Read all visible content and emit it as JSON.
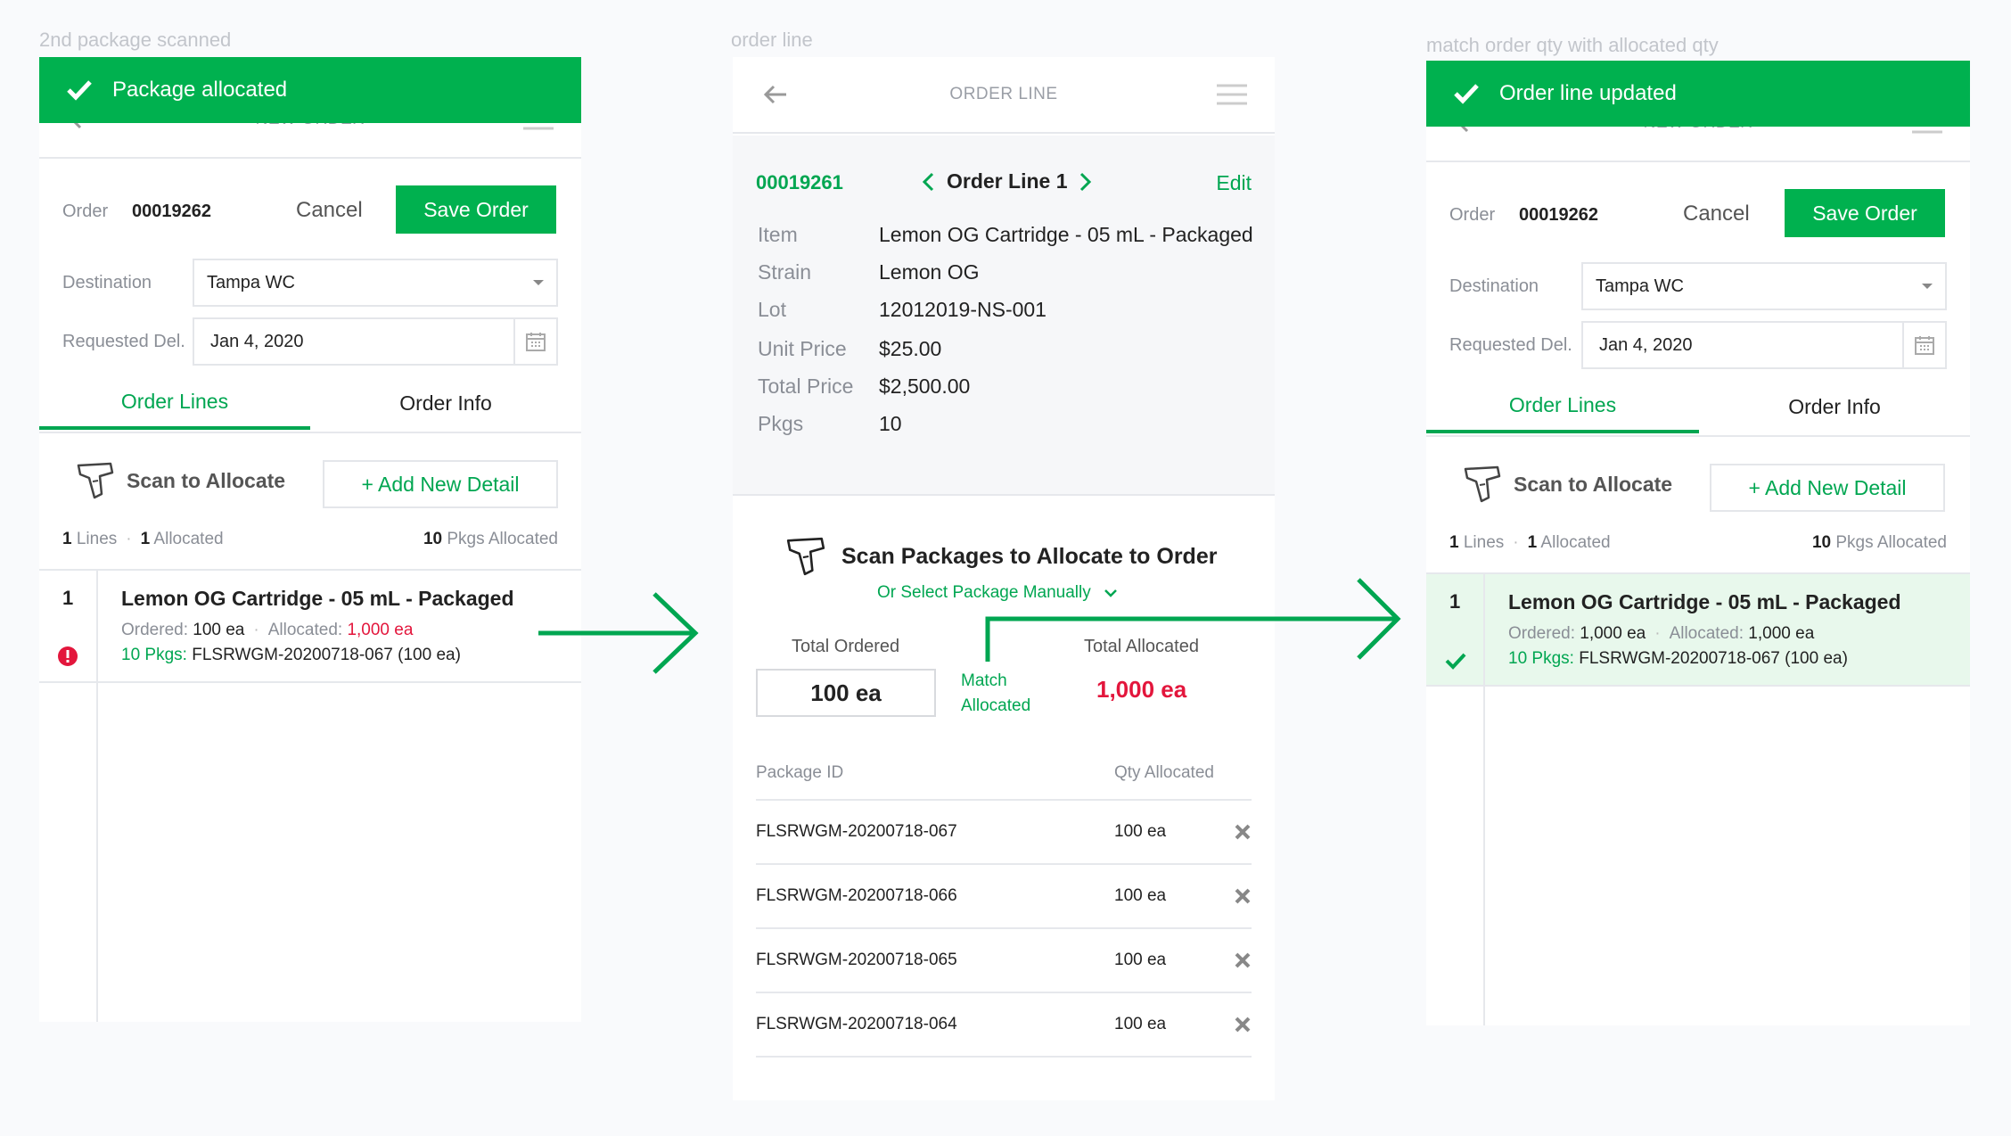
{
  "captions": {
    "left": "2nd package scanned",
    "middle": "order line",
    "right": "match order qty with allocated qty"
  },
  "left_panel": {
    "toast": "Package allocated",
    "header_title": "NEW ORDER",
    "order_label": "Order",
    "order_number": "00019262",
    "cancel_label": "Cancel",
    "save_label": "Save Order",
    "destination_label": "Destination",
    "destination_value": "Tampa WC",
    "requested_label": "Requested Del.",
    "requested_value": "Jan 4, 2020",
    "tabs": [
      "Order Lines",
      "Order Info"
    ],
    "scan_label": "Scan to Allocate",
    "add_label": "+ Add New Detail",
    "stats": {
      "lines_num": "1",
      "lines_label": "Lines",
      "alloc_num": "1",
      "alloc_label": "Allocated",
      "pkgs_num": "10",
      "pkgs_label": "Pkgs Allocated"
    },
    "line": {
      "num": "1",
      "name": "Lemon OG Cartridge - 05 mL - Packaged",
      "ordered_label": "Ordered:",
      "ordered_value": "100 ea",
      "allocated_label": "Allocated:",
      "allocated_value": "1,000 ea",
      "pkgs_label": "10 Pkgs:",
      "pkgs_value": "FLSRWGM-20200718-067 (100 ea)"
    }
  },
  "middle_panel": {
    "header_title": "ORDER LINE",
    "order_number": "00019261",
    "line_nav_label": "Order Line 1",
    "edit_label": "Edit",
    "details": [
      {
        "label": "Item",
        "value": "Lemon OG Cartridge - 05 mL - Packaged"
      },
      {
        "label": "Strain",
        "value": "Lemon OG"
      },
      {
        "label": "Lot",
        "value": "12012019-NS-001"
      },
      {
        "label": "Unit Price",
        "value": "$25.00"
      },
      {
        "label": "Total Price",
        "value": "$2,500.00"
      },
      {
        "label": "Pkgs",
        "value": "10"
      }
    ],
    "scan_title": "Scan Packages to Allocate to Order",
    "select_manually": "Or Select Package Manually",
    "total_ordered_label": "Total Ordered",
    "total_ordered_value": "100 ea",
    "match_label_1": "Match",
    "match_label_2": "Allocated",
    "total_allocated_label": "Total Allocated",
    "total_allocated_value": "1,000 ea",
    "col_package": "Package ID",
    "col_qty": "Qty Allocated",
    "packages": [
      {
        "id": "FLSRWGM-20200718-067",
        "qty": "100 ea"
      },
      {
        "id": "FLSRWGM-20200718-066",
        "qty": "100 ea"
      },
      {
        "id": "FLSRWGM-20200718-065",
        "qty": "100 ea"
      },
      {
        "id": "FLSRWGM-20200718-064",
        "qty": "100 ea"
      }
    ]
  },
  "right_panel": {
    "toast": "Order line updated",
    "header_title": "NEW ORDER",
    "order_label": "Order",
    "order_number": "00019262",
    "cancel_label": "Cancel",
    "save_label": "Save Order",
    "destination_label": "Destination",
    "destination_value": "Tampa WC",
    "requested_label": "Requested Del.",
    "requested_value": "Jan 4, 2020",
    "tabs": [
      "Order Lines",
      "Order Info"
    ],
    "scan_label": "Scan to Allocate",
    "add_label": "+ Add New Detail",
    "stats": {
      "lines_num": "1",
      "lines_label": "Lines",
      "alloc_num": "1",
      "alloc_label": "Allocated",
      "pkgs_num": "10",
      "pkgs_label": "Pkgs Allocated"
    },
    "line": {
      "num": "1",
      "name": "Lemon OG Cartridge - 05 mL - Packaged",
      "ordered_label": "Ordered:",
      "ordered_value": "1,000 ea",
      "allocated_label": "Allocated:",
      "allocated_value": "1,000 ea",
      "pkgs_label": "10 Pkgs:",
      "pkgs_value": "FLSRWGM-20200718-067 (100 ea)"
    }
  },
  "colors": {
    "accent": "#00b14f",
    "accent_text": "#00a651",
    "error": "#e3163c",
    "highlight_row": "#e8f8ec"
  },
  "icons": [
    "check-icon",
    "back-arrow-icon",
    "menu-icon",
    "calendar-icon",
    "scanner-icon",
    "error-icon",
    "close-icon",
    "chevron-left-icon",
    "chevron-right-icon",
    "chevron-down-icon",
    "flow-arrow-icon"
  ]
}
